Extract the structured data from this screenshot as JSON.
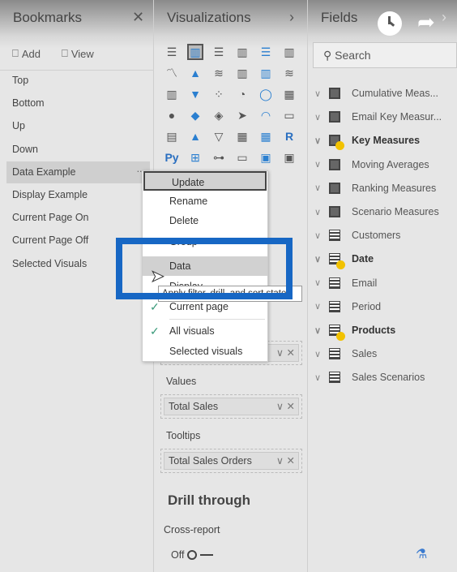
{
  "bookmarks": {
    "title": "Bookmarks",
    "close": "✕",
    "add_label": "Add",
    "view_label": "View",
    "items": [
      "Top",
      "Bottom",
      "Up",
      "Down",
      "Data Example",
      "Display Example",
      "Current Page On",
      "Current Page Off",
      "Selected Visuals"
    ],
    "selected": "Data Example",
    "more": "..."
  },
  "visualizations": {
    "title": "Visualizations",
    "expand": "›",
    "icons": [
      "stacked-bar",
      "stacked-column",
      "clustered-bar",
      "clustered-column",
      "100-bar",
      "100-column",
      "line",
      "area",
      "stacked-area",
      "line-column",
      "line-clustered",
      "ribbon",
      "waterfall",
      "funnel",
      "scatter",
      "pie",
      "donut",
      "treemap",
      "map",
      "filled-map",
      "shape-map",
      "azure-map",
      "gauge",
      "card",
      "multi-row-card",
      "kpi",
      "slicer",
      "table",
      "matrix",
      "r-visual",
      "python",
      "key-influencers",
      "decomposition-tree",
      "qa",
      "smart-narrative",
      "more"
    ],
    "icon_glyphs": [
      "☰",
      "▥",
      "☰",
      "▥",
      "☰",
      "▥",
      "〽",
      "▲",
      "≋",
      "▥",
      "▥",
      "≋",
      "▥",
      "▼",
      "⁘",
      "◔",
      "◯",
      "▦",
      "●",
      "◆",
      "◈",
      "➤",
      "◠",
      "▭",
      "▤",
      "▲",
      "▽",
      "▦",
      "▦",
      "R",
      "Py",
      "⊞",
      "⊶",
      "▭",
      "▣",
      "▣"
    ],
    "selected_icon": 1,
    "values_label": "Values",
    "values_field": "Total Sales",
    "tooltips_label": "Tooltips",
    "tooltips_field": "Total Sales Orders",
    "drill_through": "Drill through",
    "cross_report": "Cross-report",
    "cross_report_state": "Off"
  },
  "fields": {
    "title": "Fields",
    "expand": "›",
    "search_placeholder": "Search",
    "items": [
      {
        "name": "Cumulative Meas...",
        "type": "measure",
        "bold": false
      },
      {
        "name": "Email Key Measur...",
        "type": "measure",
        "bold": false
      },
      {
        "name": "Key Measures",
        "type": "measure",
        "bold": true
      },
      {
        "name": "Moving Averages",
        "type": "measure",
        "bold": false
      },
      {
        "name": "Ranking Measures",
        "type": "measure",
        "bold": false
      },
      {
        "name": "Scenario Measures",
        "type": "measure",
        "bold": false
      },
      {
        "name": "Customers",
        "type": "table",
        "bold": false
      },
      {
        "name": "Date",
        "type": "table",
        "bold": true
      },
      {
        "name": "Email",
        "type": "table",
        "bold": false
      },
      {
        "name": "Period",
        "type": "table",
        "bold": false
      },
      {
        "name": "Products",
        "type": "table",
        "bold": true
      },
      {
        "name": "Sales",
        "type": "table",
        "bold": false
      },
      {
        "name": "Sales Scenarios",
        "type": "table",
        "bold": false
      }
    ]
  },
  "context_menu": {
    "items": [
      "Update",
      "Rename",
      "Delete",
      "Group",
      "Data",
      "Display",
      "Current page",
      "All visuals",
      "Selected visuals"
    ],
    "checked": [
      "Current page",
      "All visuals"
    ],
    "hovered": "Data"
  },
  "tooltip": "Apply filter, drill, and sort state",
  "highlight_color": "#1767c4"
}
